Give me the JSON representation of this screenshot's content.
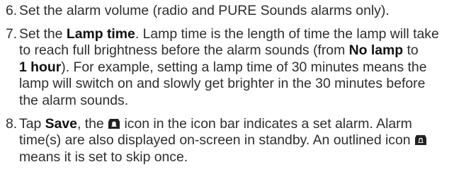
{
  "steps": [
    {
      "number": "6.",
      "lines": [
        [
          "Set the alarm volume (radio and PURE Sounds alarms only)."
        ]
      ]
    },
    {
      "number": "7.",
      "l1a": "Set the ",
      "l1b": "Lamp time",
      "l1c": ". Lamp time is the length of time the lamp will take",
      "l2a": "to reach full brightness before the alarm sounds (from ",
      "l2b": "No lamp",
      "l2c": " to",
      "l3a": "1 hour",
      "l3b": "). For example, setting a lamp time of 30 minutes means the",
      "l4": "lamp will switch on and slowly get brighter in the 30 minutes before",
      "l5": "the alarm sounds."
    },
    {
      "number": "8.",
      "l1a": "Tap ",
      "l1b": "Save",
      "l1c": ", the ",
      "l1d": " icon in the icon bar indicates a set alarm. Alarm",
      "l2": "time(s) are also displayed on-screen in standby. An outlined icon",
      "l3": "means it is set to skip once.",
      "icons": [
        "alarm-set-icon",
        "alarm-skip-once-icon"
      ]
    }
  ]
}
